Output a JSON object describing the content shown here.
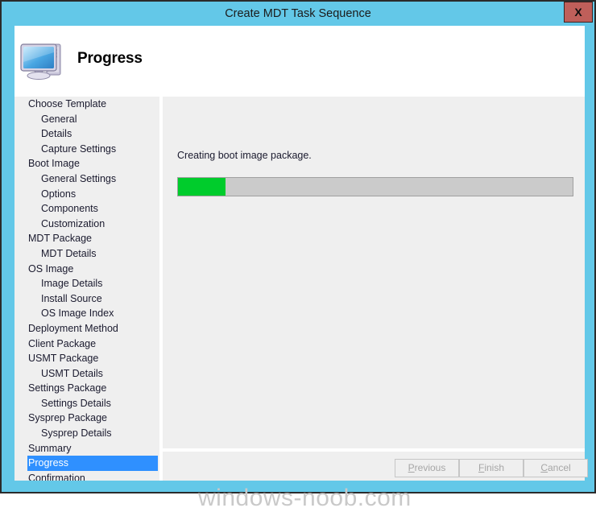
{
  "window": {
    "title": "Create MDT Task Sequence",
    "close_label": "X",
    "titlebar_color": "#63c8e8",
    "close_button_color": "#bf5f5a"
  },
  "header": {
    "title": "Progress",
    "icon": "computer-icon"
  },
  "sidebar": {
    "items": [
      {
        "label": "Choose Template",
        "level": 0,
        "selected": false
      },
      {
        "label": "General",
        "level": 1,
        "selected": false
      },
      {
        "label": "Details",
        "level": 1,
        "selected": false
      },
      {
        "label": "Capture Settings",
        "level": 1,
        "selected": false
      },
      {
        "label": "Boot Image",
        "level": 0,
        "selected": false
      },
      {
        "label": "General Settings",
        "level": 1,
        "selected": false
      },
      {
        "label": "Options",
        "level": 1,
        "selected": false
      },
      {
        "label": "Components",
        "level": 1,
        "selected": false
      },
      {
        "label": "Customization",
        "level": 1,
        "selected": false
      },
      {
        "label": "MDT Package",
        "level": 0,
        "selected": false
      },
      {
        "label": "MDT Details",
        "level": 1,
        "selected": false
      },
      {
        "label": "OS Image",
        "level": 0,
        "selected": false
      },
      {
        "label": "Image Details",
        "level": 1,
        "selected": false
      },
      {
        "label": "Install Source",
        "level": 1,
        "selected": false
      },
      {
        "label": "OS Image Index",
        "level": 1,
        "selected": false
      },
      {
        "label": "Deployment Method",
        "level": 0,
        "selected": false
      },
      {
        "label": "Client Package",
        "level": 0,
        "selected": false
      },
      {
        "label": "USMT Package",
        "level": 0,
        "selected": false
      },
      {
        "label": "USMT Details",
        "level": 1,
        "selected": false
      },
      {
        "label": "Settings Package",
        "level": 0,
        "selected": false
      },
      {
        "label": "Settings Details",
        "level": 1,
        "selected": false
      },
      {
        "label": "Sysprep Package",
        "level": 0,
        "selected": false
      },
      {
        "label": "Sysprep Details",
        "level": 1,
        "selected": false
      },
      {
        "label": "Summary",
        "level": 0,
        "selected": false
      },
      {
        "label": "Progress",
        "level": 0,
        "selected": true
      },
      {
        "label": "Confirmation",
        "level": 0,
        "selected": false
      }
    ],
    "selection_color": "#2f90ff"
  },
  "content": {
    "status_text": "Creating boot image package.",
    "progress": {
      "percent": 12,
      "fill_color": "#00cc2c",
      "track_color": "#cbcbcb"
    }
  },
  "footer": {
    "buttons": [
      {
        "name": "previous",
        "accesskey": "P",
        "rest": "revious",
        "prefix": "",
        "enabled": false
      },
      {
        "name": "finish",
        "accesskey": "F",
        "rest": "inish",
        "prefix": "",
        "enabled": false
      },
      {
        "name": "cancel",
        "accesskey": "C",
        "rest": "ancel",
        "prefix": "",
        "enabled": false
      }
    ]
  },
  "watermark": {
    "text": "windows-noob.com"
  }
}
